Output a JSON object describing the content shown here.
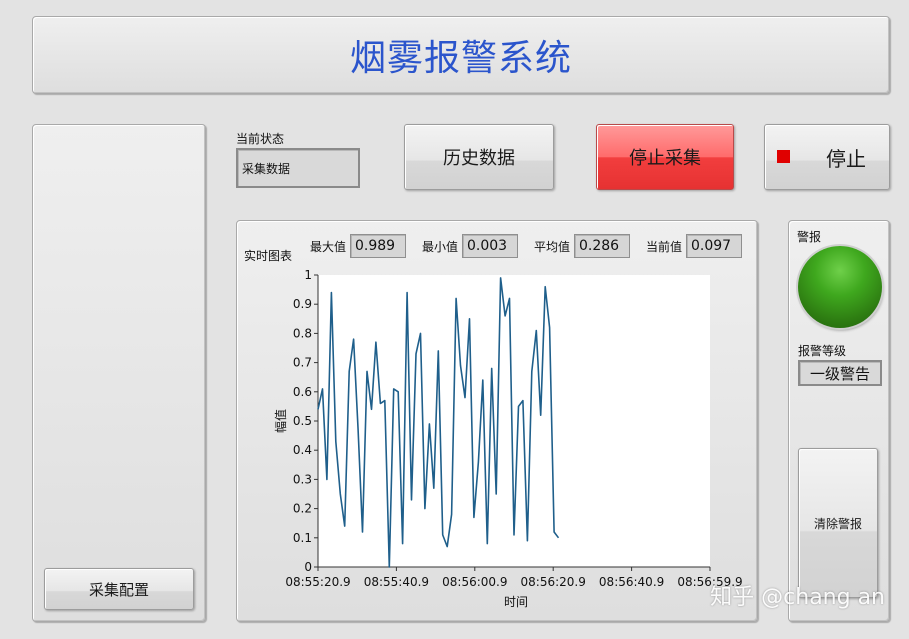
{
  "title": "烟雾报警系统",
  "colors": {
    "title": "#2b55cc",
    "series": "#1f5f8b",
    "alarm_light": "#2e8b16",
    "stop_indicator": "#e00000"
  },
  "status": {
    "label": "当前状态",
    "value": "采集数据"
  },
  "buttons": {
    "history": "历史数据",
    "stop_collect": "停止采集",
    "stop": "停止",
    "config": "采集配置",
    "clear_alarm": "清除警报"
  },
  "stats": [
    {
      "label": "最大值",
      "value": "0.989"
    },
    {
      "label": "最小值",
      "value": "0.003"
    },
    {
      "label": "平均值",
      "value": "0.286"
    },
    {
      "label": "当前值",
      "value": "0.097"
    }
  ],
  "alarm": {
    "label": "警报",
    "level_label": "报警等级",
    "level_value": "一级警告"
  },
  "watermark": "知乎 @chang an",
  "chart_data": {
    "type": "line",
    "title": "实时图表",
    "xlabel": "时间",
    "ylabel": "幅值",
    "ylim": [
      0,
      1
    ],
    "xlim": [
      0,
      88
    ],
    "yticks": [
      "0",
      "0.1",
      "0.2",
      "0.3",
      "0.4",
      "0.5",
      "0.6",
      "0.7",
      "0.8",
      "0.9",
      "1"
    ],
    "xticks": [
      "08:55:20.9",
      "08:55:40.9",
      "08:56:00.9",
      "08:56:20.9",
      "08:56:40.9",
      "08:56:59.9"
    ],
    "grid": false,
    "series": [
      {
        "values": [
          0.54,
          0.61,
          0.3,
          0.94,
          0.43,
          0.25,
          0.14,
          0.67,
          0.78,
          0.47,
          0.12,
          0.67,
          0.54,
          0.77,
          0.56,
          0.57,
          0.0,
          0.61,
          0.6,
          0.08,
          0.94,
          0.23,
          0.73,
          0.8,
          0.2,
          0.49,
          0.27,
          0.74,
          0.11,
          0.07,
          0.18,
          0.92,
          0.69,
          0.58,
          0.85,
          0.17,
          0.36,
          0.64,
          0.08,
          0.68,
          0.25,
          0.99,
          0.86,
          0.92,
          0.11,
          0.55,
          0.57,
          0.09,
          0.67,
          0.81,
          0.52,
          0.96,
          0.82,
          0.12,
          0.1
        ]
      }
    ]
  }
}
